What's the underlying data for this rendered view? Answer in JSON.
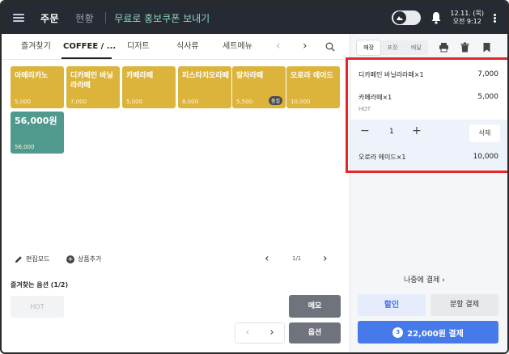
{
  "topbar": {
    "tab_order": "주문",
    "tab_status": "현황",
    "promo": "무료로 홍보쿠폰 보내기",
    "date": "12.11. (목)",
    "time": "오전 9:12"
  },
  "categories": {
    "items": [
      "즐겨찾기",
      "COFFEE / ...",
      "디저트",
      "식사류",
      "세트메뉴"
    ],
    "active_index": 1
  },
  "products": [
    {
      "name": "아메리카노",
      "price": "5,000"
    },
    {
      "name": "디카페인 바닐라라떼",
      "price": "7,000"
    },
    {
      "name": "카페라떼",
      "price": "5,000"
    },
    {
      "name": "피스타치오라떼",
      "price": "8,000"
    },
    {
      "name": "말차라떼",
      "price": "5,500",
      "badge": "품절"
    },
    {
      "name": "오로라 에이드",
      "price": "10,000"
    },
    {
      "name": "56,000원",
      "price": "56,000"
    }
  ],
  "left_controls": {
    "edit_mode": "편집모드",
    "add_product": "상품추가",
    "pager": "1/1",
    "fav_options_title": "즐겨찾는 옵션 (1/2)",
    "hot": "HOT",
    "memo": "메모",
    "select": "옵션"
  },
  "right_panel": {
    "seg": [
      "매장",
      "포장",
      "배달"
    ],
    "seg_active": 0,
    "order": [
      {
        "name": "디카페인 바닐라라떼×1",
        "amount": "7,000"
      },
      {
        "name": "카페라떼×1",
        "amount": "5,000",
        "option": "HOT"
      },
      {
        "name": "오로라 에이드×1",
        "amount": "10,000"
      }
    ],
    "qty": "1",
    "delete": "삭제",
    "later_pay": "나중에 결제",
    "discount": "할인",
    "split_pay": "분할 결제",
    "pay_count": "3",
    "pay_label": "22,000원 결제"
  },
  "colors": {
    "topbar": "#262a33",
    "tile_yellow": "#dcb43b",
    "tile_green": "#4f9a8c",
    "pay_blue": "#4679ea",
    "highlight_red": "#e4262b"
  }
}
